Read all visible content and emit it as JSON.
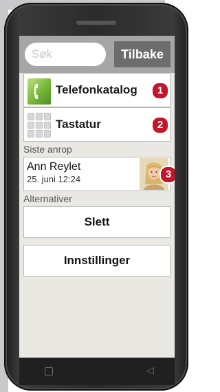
{
  "search": {
    "placeholder": "Søk"
  },
  "header": {
    "back_label": "Tilbake"
  },
  "menu": {
    "phonebook_label": "Telefonkatalog",
    "keypad_label": "Tastatur"
  },
  "sections": {
    "recent_calls": "Siste anrop",
    "alternatives": "Alternativer"
  },
  "recent_call": {
    "name": "Ann Reylet",
    "datetime": "25. juni 12:24"
  },
  "actions": {
    "delete": "Slett",
    "settings": "Innstillinger"
  },
  "badges": [
    "1",
    "2",
    "3"
  ],
  "colors": {
    "badge": "#c4152c",
    "top_bar": "#a6a6a6",
    "back_button": "#6d6d6d",
    "screen_bg": "#e9e8e3",
    "phone_icon_green": "#75b53a"
  },
  "icons": {
    "phonebook": "phone-handset-icon",
    "keypad": "keypad-icon",
    "avatar": "contact-photo",
    "nav_overview": "square-icon",
    "nav_back": "triangle-back-icon"
  }
}
